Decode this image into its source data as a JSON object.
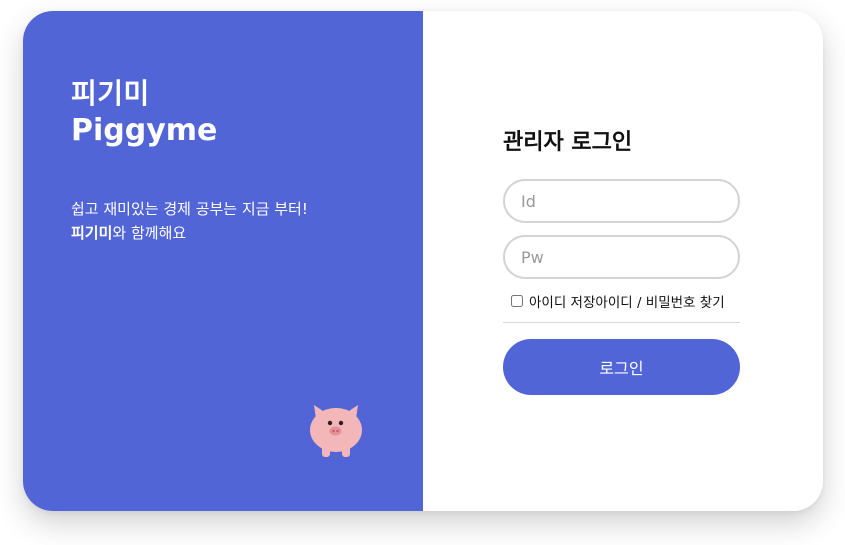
{
  "brand": {
    "name_ko": "피기미",
    "name_en": "Piggyme",
    "tagline_line1": "쉽고 재미있는 경제 공부는 지금 부터!",
    "tagline_brand": "피기미",
    "tagline_line2_rest": "와 함께해요"
  },
  "login": {
    "title": "관리자 로그인",
    "id_placeholder": "Id",
    "pw_placeholder": "Pw",
    "remember_label": "아이디 저장",
    "find_link": "아이디 / 비밀번호 찾기",
    "submit_label": "로그인"
  },
  "colors": {
    "accent": "#5165d6",
    "pig": "#f4b7b9",
    "pig_snout": "#e78f97"
  },
  "icons": {
    "mascot": "pig-icon"
  }
}
